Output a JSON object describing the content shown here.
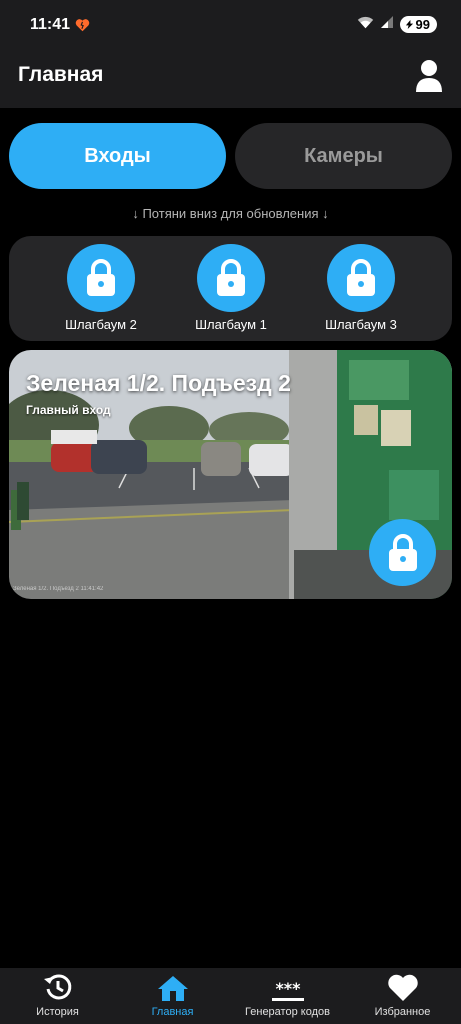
{
  "status_bar": {
    "time": "11:41",
    "battery": "99",
    "icons": [
      "heart-icon",
      "wifi-icon",
      "signal-icon",
      "battery-icon"
    ]
  },
  "header": {
    "title": "Главная",
    "profile_icon": "person-icon"
  },
  "tabs": [
    {
      "label": "Входы",
      "active": true
    },
    {
      "label": "Камеры",
      "active": false
    }
  ],
  "pull_hint": "↓ Потяни вниз для обновления ↓",
  "barriers": [
    {
      "label": "Шлагбаум 2",
      "icon": "lock-icon"
    },
    {
      "label": "Шлагбаум 1",
      "icon": "lock-icon"
    },
    {
      "label": "Шлагбаум 3",
      "icon": "lock-icon"
    }
  ],
  "entrance": {
    "title": "Зеленая 1/2. Подъезд 2",
    "subtitle": "Главный вход",
    "camera_overlay": "Зеленая 1/2. Подъезд 2  11:41:42",
    "icon": "lock-icon"
  },
  "bottom_nav": [
    {
      "label": "История",
      "icon": "history-icon",
      "active": false
    },
    {
      "label": "Главная",
      "icon": "home-icon",
      "active": true
    },
    {
      "label": "Генератор кодов",
      "icon": "code-generator-icon",
      "active": false
    },
    {
      "label": "Избранное",
      "icon": "heart-icon",
      "active": false
    }
  ],
  "colors": {
    "accent": "#2eaef5",
    "background": "#000000",
    "surface": "#262628",
    "bar": "#1c1c1e"
  }
}
